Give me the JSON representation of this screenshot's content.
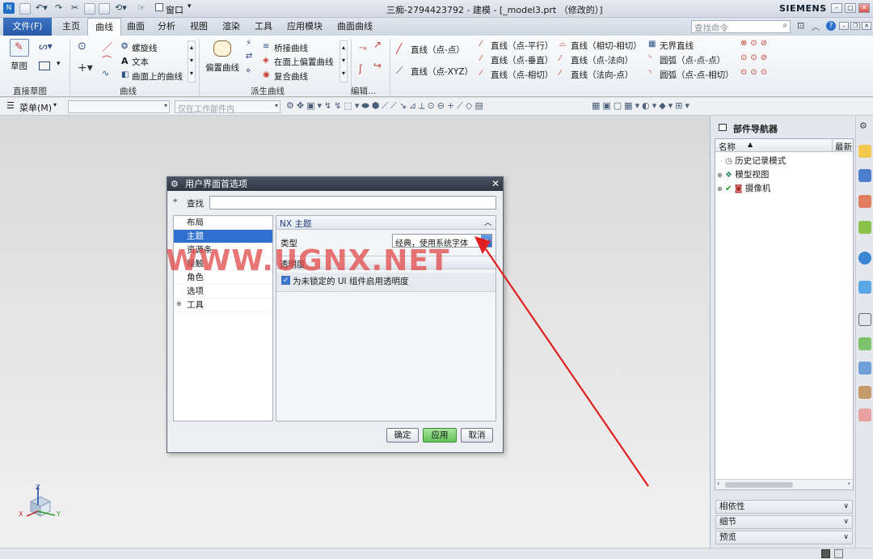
{
  "window": {
    "title": "三痴-2794423792 - 建模 - [_model3.prt （修改的）]",
    "brand": "SIEMENS",
    "window_menu": "窗口",
    "search_placeholder": "查找命令"
  },
  "tabs": [
    "文件(F)",
    "主页",
    "曲线",
    "曲面",
    "分析",
    "视图",
    "渲染",
    "工具",
    "应用模块",
    "曲面曲线"
  ],
  "active_tab": "曲线",
  "ribbon": {
    "sketch_label": "草图",
    "group_direct_sketch": "直接草图",
    "group_curve": "曲线",
    "curve_items": [
      "螺旋线",
      "文本",
      "曲面上的曲线"
    ],
    "offset_curve": "偏置曲线",
    "derived_items": [
      "桥接曲线",
      "在面上偏置曲线",
      "复合曲线"
    ],
    "group_derived": "派生曲线",
    "group_edit": "编辑...",
    "line_pt_pt": "直线（点-点）",
    "line_pt_xyz": "直线（点-XYZ）",
    "col3": [
      "直线（点-平行）",
      "直线（点-垂直）",
      "直线（点-相切）"
    ],
    "col4": [
      "直线（相切-相切）",
      "直线（点-法向）",
      "直线（法向-点）"
    ],
    "col5": [
      "无界直线",
      "圆弧（点-点-点）",
      "圆弧（点-点-相切）"
    ]
  },
  "toolbar2": {
    "menu": "菜单(M)",
    "filter_placeholder": "仅在工作部件内"
  },
  "navigator": {
    "title": "部件导航器",
    "col_name": "名称",
    "col_latest": "最新",
    "items": [
      "历史记录模式",
      "模型视图",
      "摄像机"
    ]
  },
  "accordions": [
    "相依性",
    "细节",
    "预览"
  ],
  "dialog": {
    "title": "用户界面首选项",
    "search_label": "查找",
    "tree": [
      "布局",
      "主题",
      "资源条",
      "接触",
      "角色",
      "选项",
      "工具"
    ],
    "selected_tree": "主题",
    "section_title": "NX 主题",
    "type_label": "类型",
    "type_value": "经典，使用系统字体",
    "transparency_label": "透明度",
    "checkbox_label": "为未锁定的 UI 组件启用透明度",
    "checkbox_checked": true,
    "btn_ok": "确定",
    "btn_apply": "应用",
    "btn_cancel": "取消"
  },
  "watermark": "WWW.UGNX.NET",
  "axes": {
    "z": "Z",
    "x": "X",
    "y": "Y"
  },
  "colors": {
    "accent": "#2a5ca8",
    "annotation_arrow": "#e02020",
    "apply_button": "#78d070"
  }
}
